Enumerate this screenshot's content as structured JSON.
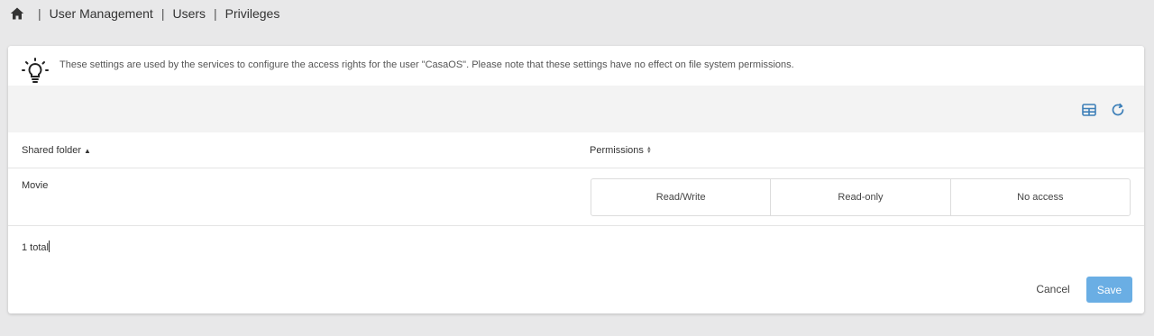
{
  "breadcrumb": {
    "home_icon": "home-icon",
    "items": [
      "User Management",
      "Users",
      "Privileges"
    ],
    "separator": "|"
  },
  "info": {
    "icon": "lightbulb-icon",
    "text": "These settings are used by the services to configure the access rights for the user \"CasaOS\". Please note that these settings have no effect on file system permissions."
  },
  "toolbar": {
    "icons": [
      "table-columns-icon",
      "refresh-icon"
    ],
    "accent": "#3d7fb8"
  },
  "table": {
    "columns": [
      {
        "label": "Shared folder",
        "sort": "ascending"
      },
      {
        "label": "Permissions",
        "sort": "none"
      }
    ],
    "rows": [
      {
        "folder": "Movie",
        "options": [
          "Read/Write",
          "Read-only",
          "No access"
        ]
      }
    ],
    "footer": "1 total"
  },
  "actions": {
    "cancel_label": "Cancel",
    "save_label": "Save",
    "save_color": "#6aaee4"
  }
}
